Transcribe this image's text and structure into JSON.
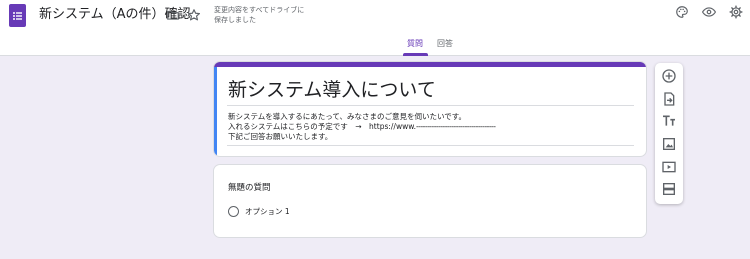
{
  "header": {
    "app_icon": "google-forms-icon",
    "title": "新システム（Aの件）確認",
    "save_status_line1": "変更内容をすべてドライブに",
    "save_status_line2": "保存しました",
    "icons": [
      "folder-icon",
      "star-icon",
      "palette-icon",
      "eye-icon",
      "gear-icon"
    ]
  },
  "tabs": [
    {
      "label": "質問",
      "active": true
    },
    {
      "label": "回答",
      "active": false
    }
  ],
  "form": {
    "title": "新システム導入について",
    "description": [
      "新システムを導入するにあたって、みなさまのご意見を伺いたいです。",
      "入れるシステムはこちらの予定です　→　https://www.",
      "下記ご回答お願いいたします。"
    ],
    "url_mask": "------------------------------------"
  },
  "question": {
    "title": "無題の質問",
    "option": "オプション 1"
  },
  "toolbar": {
    "tools": [
      "add-question-icon",
      "import-questions-icon",
      "add-title-icon",
      "add-image-icon",
      "add-video-icon",
      "add-section-icon"
    ]
  },
  "colors": {
    "accent": "#673ab7",
    "background": "#efecf6",
    "focus": "#4285f4"
  }
}
